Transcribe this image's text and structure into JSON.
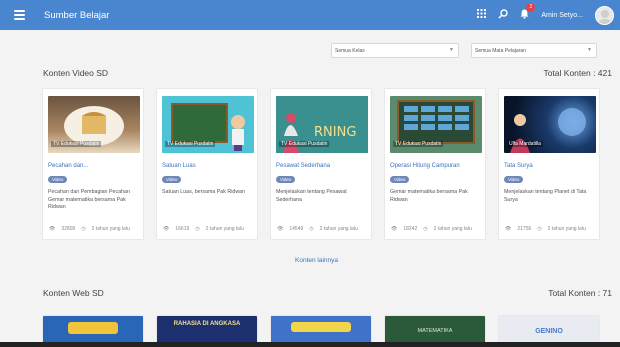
{
  "app": {
    "title": "Sumber Belajar",
    "user_name": "Amin Setyo...",
    "notification_count": "2"
  },
  "icons": {
    "menu": "hamburger-icon",
    "apps": "grid-icon",
    "search": "search-icon",
    "bell": "bell-icon"
  },
  "filters": {
    "kelas": "Semua Kelas",
    "mapel": "Semua Mata Pelajaran"
  },
  "video_section": {
    "title": "Konten Video SD",
    "total": "Total Konten : 421",
    "cards": [
      {
        "thumb_label": "TV Edukasi Pusdatin",
        "title": "Pecahan dan...",
        "badge": "Video",
        "desc": "Pecahan dan Pembagian Pecahan Gemar matematika bersama Pak Ridwan",
        "views": "32809",
        "time": "2 tahun yang lalu"
      },
      {
        "thumb_label": "TV Edukasi Pusdatin",
        "title": "Satuan Luas",
        "badge": "Video",
        "desc": "Satuan Luas, bersama Pak Ridwan",
        "views": "16619",
        "time": "2 tahun yang lalu"
      },
      {
        "thumb_label": "TV Edukasi Pusdatin",
        "title": "Pesawat Sederhana",
        "badge": "Video",
        "desc": "Menjelaskan tentang Pesawat Sederhana",
        "views": "14549",
        "time": "2 tahun yang lalu"
      },
      {
        "thumb_label": "TV Edukasi Pusdatin",
        "title": "Operasi Hitung Campuran",
        "badge": "Video",
        "desc": "Gemar matematika bersama Pak Ridwan",
        "views": "18242",
        "time": "2 tahun yang lalu"
      },
      {
        "thumb_label": "Ulfa Mardatilla",
        "title": "Tata Surya",
        "badge": "Video",
        "desc": "Menjelaskan tentang Planet di Tata Surya",
        "views": "21756",
        "time": "2 tahun yang lalu"
      }
    ],
    "more_label": "Konten lainnya"
  },
  "web_section": {
    "title": "Konten Web SD",
    "total": "Total Konten : 71",
    "thumbs": [
      "",
      "RAHASIA DI ANGKASA",
      "",
      "MATEMATIKA",
      "GENINO"
    ]
  },
  "colors": {
    "topbar": "#4a86d0",
    "link": "#3a73c2",
    "badge": "#6e87b8"
  }
}
